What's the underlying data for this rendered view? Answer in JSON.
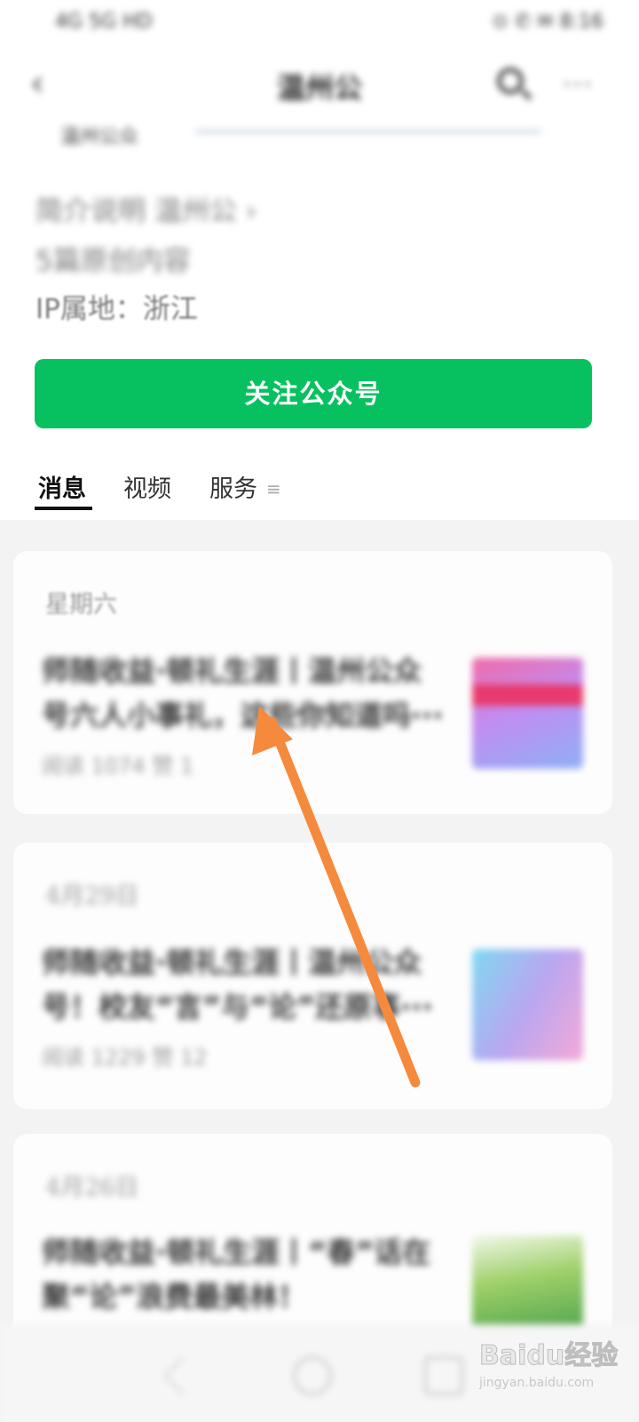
{
  "status_bar": {
    "left": "4G 5G HD",
    "right": "⊙ ✆ ✉ 8:16"
  },
  "nav": {
    "back_icon": "chevron-left-icon",
    "title": "温州公",
    "search_icon": "search-icon",
    "more_label": "···"
  },
  "account": {
    "avatar_label": "温州公众",
    "name_line": "简介说明 温州公 ›",
    "desc_line": "5篇原创内容",
    "ip_location": "IP属地：浙江"
  },
  "follow_button": "关注公众号",
  "tabs": [
    {
      "label": "消息"
    },
    {
      "label": "视频"
    },
    {
      "label": "服务"
    }
  ],
  "tab_menu_icon": "≡",
  "articles": [
    {
      "date": "星期六",
      "title": "师随收益·顿礼生涯丨温州公众号六人小事礼，这些你知道吗···",
      "meta": "阅读 1074 赞 1"
    },
    {
      "date": "4月29日",
      "title": "师随收益·顿礼生涯丨温州公众号！校友“言”与“论”还原事···",
      "meta": "阅读 1229 赞 12"
    },
    {
      "date": "4月26日",
      "title": "师随收益·顿礼生涯丨“春”话在聚“论”浪费最美林！",
      "meta": ""
    }
  ],
  "system_nav": {
    "back_icon": "back-triangle-icon",
    "home_icon": "home-circle-icon",
    "recent_icon": "recent-square-icon"
  },
  "watermark": {
    "main": "Baidu经验",
    "sub": "jingyan.baidu.com"
  },
  "colors": {
    "accent": "#07c160",
    "arrow": "#f58a3c",
    "background": "#f3f3f3"
  }
}
